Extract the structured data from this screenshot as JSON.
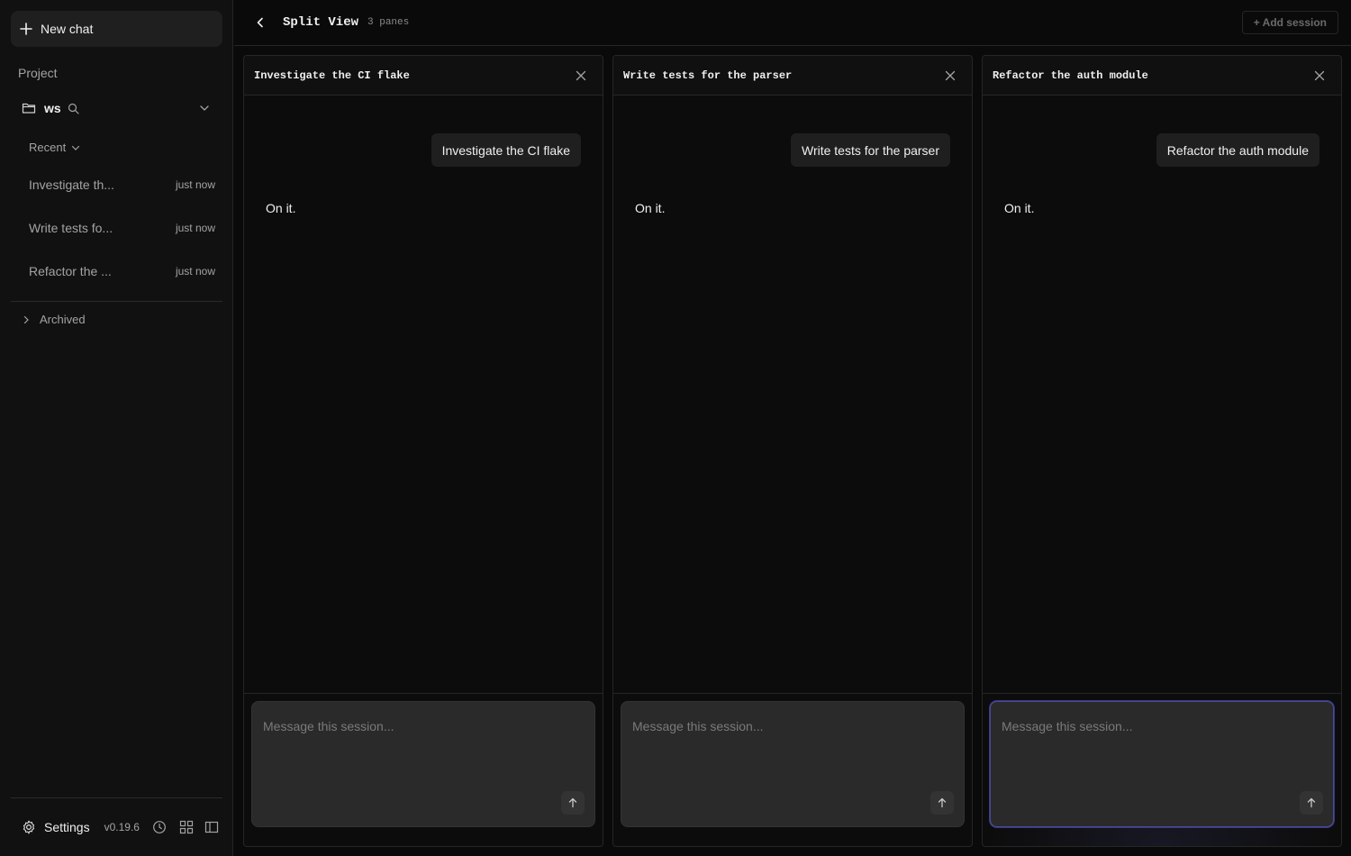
{
  "sidebar": {
    "new_chat_label": "New chat",
    "project_label": "Project",
    "workspace_name": "ws",
    "recent_label": "Recent",
    "sessions": [
      {
        "title": "Investigate th...",
        "time": "just now"
      },
      {
        "title": "Write tests fo...",
        "time": "just now"
      },
      {
        "title": "Refactor the ...",
        "time": "just now"
      }
    ],
    "archived_label": "Archived",
    "settings_label": "Settings",
    "version": "v0.19.6"
  },
  "header": {
    "title": "Split View",
    "pane_count": "3 panes",
    "add_session_label": "+ Add session"
  },
  "panes": [
    {
      "title": "Investigate the CI flake",
      "user_message": "Investigate the CI flake",
      "assistant_message": "On it.",
      "composer_placeholder": "Message this session..."
    },
    {
      "title": "Write tests for the parser",
      "user_message": "Write tests for the parser",
      "assistant_message": "On it.",
      "composer_placeholder": "Message this session..."
    },
    {
      "title": "Refactor the auth module",
      "user_message": "Refactor the auth module",
      "assistant_message": "On it.",
      "composer_placeholder": "Message this session..."
    }
  ],
  "colors": {
    "background": "#0a0a0a",
    "sidebar": "#111111",
    "composer": "#2a2a2a",
    "focus_ring": "#4a4a9a"
  },
  "icons": {
    "new_chat": "plus-icon",
    "workspace": "folder-icon",
    "workspace_search": "search-icon",
    "workspace_toggle": "chevron-down-icon",
    "settings": "gear-icon",
    "history": "clock-icon",
    "grid": "grid-icon",
    "panel": "panel-icon",
    "back": "chevron-left-icon",
    "close": "close-icon",
    "send": "arrow-up-icon"
  }
}
